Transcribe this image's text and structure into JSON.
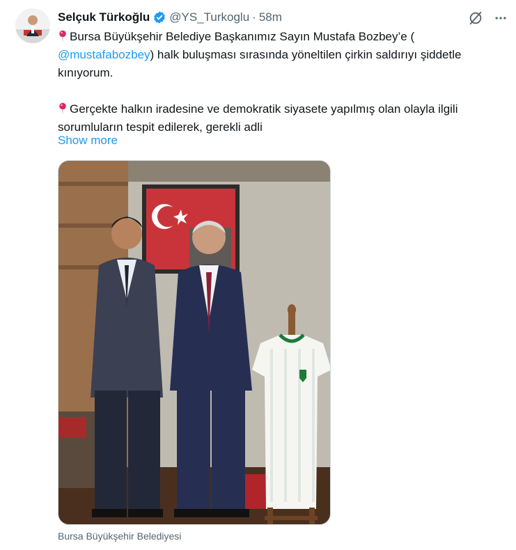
{
  "author": {
    "display_name": "Selçuk Türkoğlu",
    "handle": "@YS_Turkoglu",
    "separator": "·",
    "time": "58m",
    "verified": true
  },
  "tweet": {
    "paragraph1_pre": "Bursa Büyükşehir Belediye Başkanımız Sayın Mustafa Bozbey’e (",
    "mention": "@mustafabozbey",
    "paragraph1_post": ") halk buluşması sırasında yöneltilen çirkin saldırıyı şiddetle kınıyorum.",
    "paragraph2": "Gerçekte halkın iradesine ve demokratik siyasete yapılmış olan olayla ilgili sorumluların tespit edilerek, gerekli adli",
    "show_more": "Show more",
    "pin_icon": "round-pushpin-emoji"
  },
  "media": {
    "caption": "Bursa Büyükşehir Belediyesi",
    "icon": "photo"
  },
  "icons": {
    "grok": "grok-icon",
    "more": "more-icon",
    "verified": "verified-badge-icon"
  },
  "colors": {
    "accent": "#1d9bf0",
    "secondary_text": "#536471",
    "primary_text": "#0f1419"
  }
}
